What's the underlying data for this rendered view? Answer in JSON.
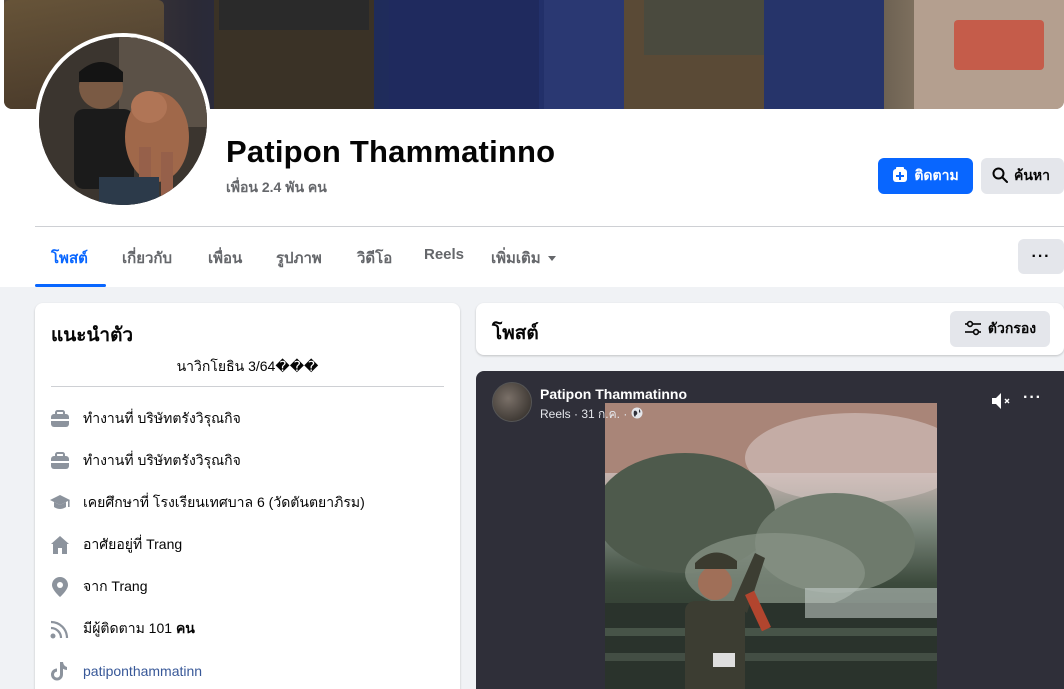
{
  "profile": {
    "name": "Patipon Thammatinno",
    "friends": "เพื่อน 2.4 พัน คน",
    "follow_label": "ติดตาม",
    "search_label": "ค้นหา"
  },
  "tabs": [
    {
      "label": "โพสต์"
    },
    {
      "label": "เกี่ยวกับ"
    },
    {
      "label": "เพื่อน"
    },
    {
      "label": "รูปภาพ"
    },
    {
      "label": "วิดีโอ"
    },
    {
      "label": "Reels"
    },
    {
      "label": "เพิ่มเติม"
    }
  ],
  "more_menu_label": "···",
  "intro": {
    "title": "แนะนำตัว",
    "bio": "นาวิกโยธิน 3/64���",
    "items": [
      {
        "icon": "briefcase-icon",
        "text": "ทำงานที่ บริษัทตรังวิรุณกิจ"
      },
      {
        "icon": "briefcase-icon",
        "text": "ทำงานที่ บริษัทตรังวิรุณกิจ"
      },
      {
        "icon": "graduation-cap-icon",
        "text": "เคยศึกษาที่ โรงเรียนเทศบาล 6 (วัดตันตยาภิรม)"
      },
      {
        "icon": "home-icon",
        "text": "อาศัยอยู่ที่ Trang"
      },
      {
        "icon": "location-pin-icon",
        "text": "จาก Trang"
      },
      {
        "icon": "rss-icon",
        "text_prefix": "มีผู้ติดตาม 101 ",
        "text_bold": "คน"
      },
      {
        "icon": "tiktok-icon",
        "text": "patiponthammatinn"
      }
    ]
  },
  "posts": {
    "title": "โพสต์",
    "filter_label": "ตัวกรอง"
  },
  "reel": {
    "author": "Patipon Thammatinno",
    "meta": "Reels · 31 ก.ค. ·",
    "more_label": "···"
  },
  "colors": {
    "accent": "#0866ff",
    "secondary_button": "#e4e6eb",
    "background": "#f0f2f5"
  }
}
